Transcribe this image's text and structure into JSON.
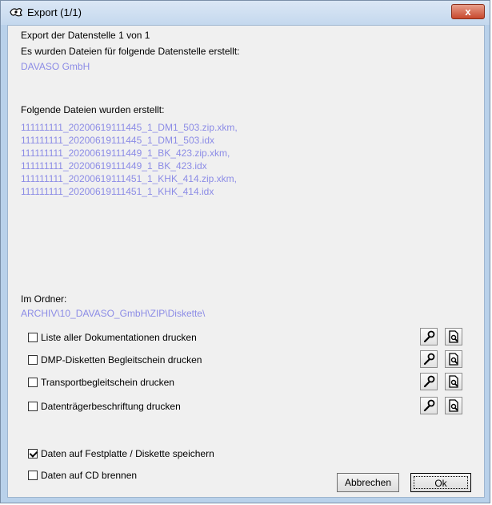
{
  "window": {
    "title": "Export (1/1)",
    "close_label": "x"
  },
  "header": {
    "export_line": "Export der Datenstelle 1 von 1",
    "created_for": "Es wurden Dateien für folgende Datenstelle erstellt:",
    "datastelle": "DAVASO GmbH",
    "files_heading": "Folgende Dateien wurden erstellt:"
  },
  "files": [
    "111111111_20200619111445_1_DM1_503.zip.xkm,",
    "111111111_20200619111445_1_DM1_503.idx",
    "111111111_20200619111449_1_BK_423.zip.xkm,",
    "111111111_20200619111449_1_BK_423.idx",
    "111111111_20200619111451_1_KHK_414.zip.xkm,",
    "111111111_20200619111451_1_KHK_414.idx"
  ],
  "folder": {
    "label": "Im Ordner:",
    "path": "ARCHIV\\10_DAVASO_GmbH\\ZIP\\Diskette\\"
  },
  "print_options": [
    {
      "label": "Liste aller Dokumentationen drucken",
      "checked": false
    },
    {
      "label": "DMP-Disketten Begleitschein drucken",
      "checked": false
    },
    {
      "label": "Transportbegleitschein drucken",
      "checked": false
    },
    {
      "label": "Datenträgerbeschriftung drucken",
      "checked": false
    }
  ],
  "save_options": {
    "save_disk": {
      "label": "Daten auf Festplatte / Diskette speichern",
      "checked": true
    },
    "burn_cd": {
      "label": "Daten auf CD brennen",
      "checked": false
    }
  },
  "buttons": {
    "cancel": "Abbrechen",
    "ok": "Ok"
  },
  "icons": {
    "settings": "wrench-key-icon",
    "preview": "print-preview-icon"
  }
}
